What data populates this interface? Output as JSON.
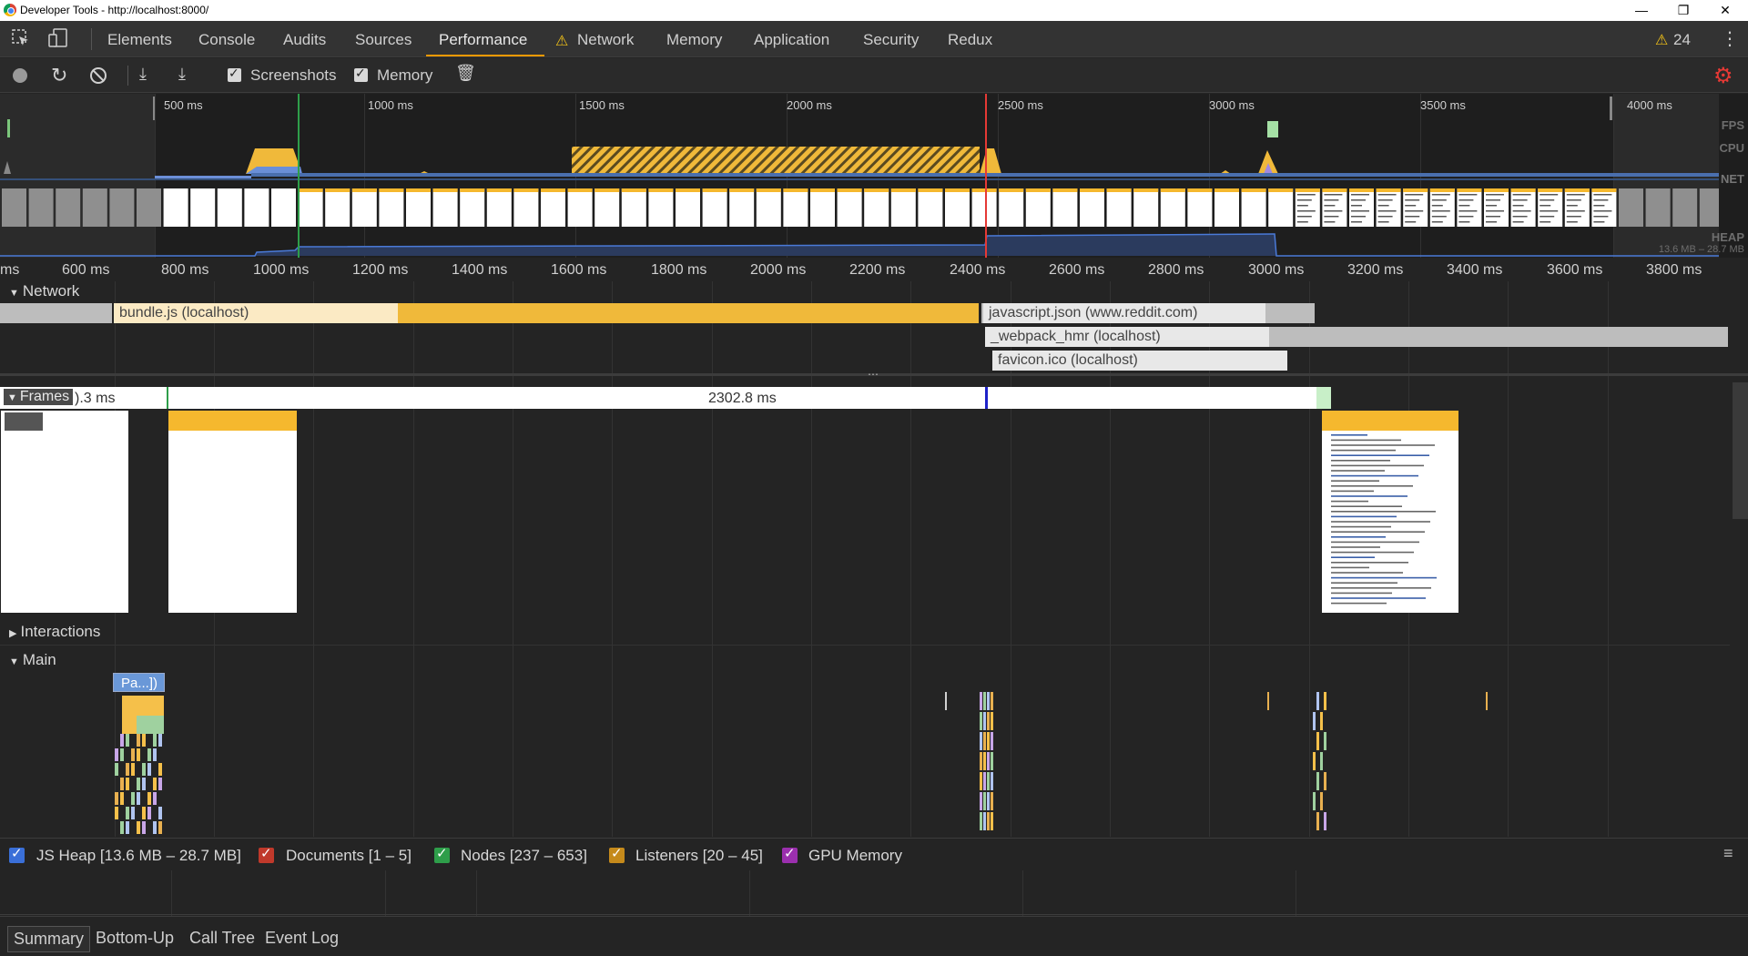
{
  "window": {
    "title": "Developer Tools - http://localhost:8000/"
  },
  "tabs": [
    "Elements",
    "Console",
    "Audits",
    "Sources",
    "Performance",
    "Network",
    "Memory",
    "Application",
    "Security",
    "Redux"
  ],
  "active_tab": "Performance",
  "warning_count": "24",
  "toolbar": {
    "screenshots_label": "Screenshots",
    "memory_label": "Memory"
  },
  "overview": {
    "ticks": [
      "500 ms",
      "1000 ms",
      "1500 ms",
      "2000 ms",
      "2500 ms",
      "3000 ms",
      "3500 ms",
      "4000 ms"
    ],
    "labels": {
      "fps": "FPS",
      "cpu": "CPU",
      "net": "NET",
      "heap": "HEAP"
    },
    "heap_range": "13.6 MB – 28.7 MB"
  },
  "ruler": {
    "ticks": [
      "ms",
      "600 ms",
      "800 ms",
      "1000 ms",
      "1200 ms",
      "1400 ms",
      "1600 ms",
      "1800 ms",
      "2000 ms",
      "2200 ms",
      "2400 ms",
      "2600 ms",
      "2800 ms",
      "3000 ms",
      "3200 ms",
      "3400 ms",
      "3600 ms",
      "3800 ms"
    ]
  },
  "network": {
    "header": "Network",
    "requests": [
      {
        "label": "bundle.js (localhost)"
      },
      {
        "label": "javascript.json (www.reddit.com)"
      },
      {
        "label": "_webpack_hmr (localhost)"
      },
      {
        "label": "favicon.ico (localhost)"
      }
    ]
  },
  "frames": {
    "header": "Frames",
    "first_frame": ").3 ms",
    "long_frame": "2302.8 ms"
  },
  "interactions": {
    "header": "Interactions"
  },
  "main": {
    "header": "Main",
    "task_label": "Pa...])"
  },
  "memory_legend": [
    {
      "label": "JS Heap [13.6 MB – 28.7 MB]",
      "color": "#3a6fd8"
    },
    {
      "label": "Documents [1 – 5]",
      "color": "#c0392b"
    },
    {
      "label": "Nodes [237 – 653]",
      "color": "#2e9e4a"
    },
    {
      "label": "Listeners [20 – 45]",
      "color": "#c58a1b"
    },
    {
      "label": "GPU Memory",
      "color": "#9b2fae"
    }
  ],
  "bottom_tabs": [
    "Summary",
    "Bottom-Up",
    "Call Tree",
    "Event Log"
  ],
  "active_bottom_tab": "Summary"
}
